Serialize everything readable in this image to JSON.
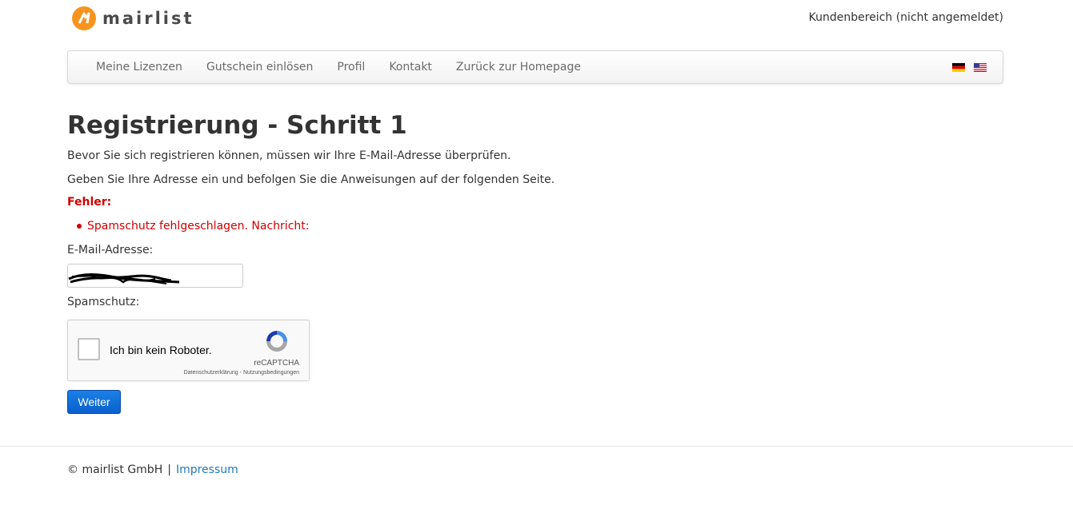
{
  "header": {
    "brand": "mairlist",
    "account_link": "Kundenbereich (nicht angemeldet)",
    "brand_color": "#f7941d"
  },
  "nav": {
    "items": [
      {
        "label": "Meine Lizenzen"
      },
      {
        "label": "Gutschein einlösen"
      },
      {
        "label": "Profil"
      },
      {
        "label": "Kontakt"
      },
      {
        "label": "Zurück zur Homepage"
      }
    ],
    "flags": [
      "flag-de-icon",
      "flag-us-icon"
    ]
  },
  "main": {
    "title": "Registrierung - Schritt 1",
    "intro1": "Bevor Sie sich registrieren können, müssen wir Ihre E-Mail-Adresse überprüfen.",
    "intro2": "Geben Sie Ihre Adresse ein und befolgen Sie die Anweisungen auf der folgenden Seite.",
    "error_label": "Fehler:",
    "errors": [
      "Spamschutz fehlgeschlagen. Nachricht:"
    ],
    "email_label": "E-Mail-Adresse:",
    "email_value": "",
    "spam_label": "Spamschutz:",
    "recaptcha": {
      "label": "Ich bin kein Roboter.",
      "brand": "reCAPTCHA",
      "privacy": "Datenschutzerklärung",
      "link_sep": " - ",
      "terms": "Nutzungsbedingungen"
    },
    "submit_label": "Weiter",
    "error_color": "#d00000",
    "button_color": "#0a6ad8"
  },
  "footer": {
    "copyright": "© mairlist GmbH",
    "separator": "|",
    "impressum": "Impressum",
    "link_color": "#2479b8"
  }
}
